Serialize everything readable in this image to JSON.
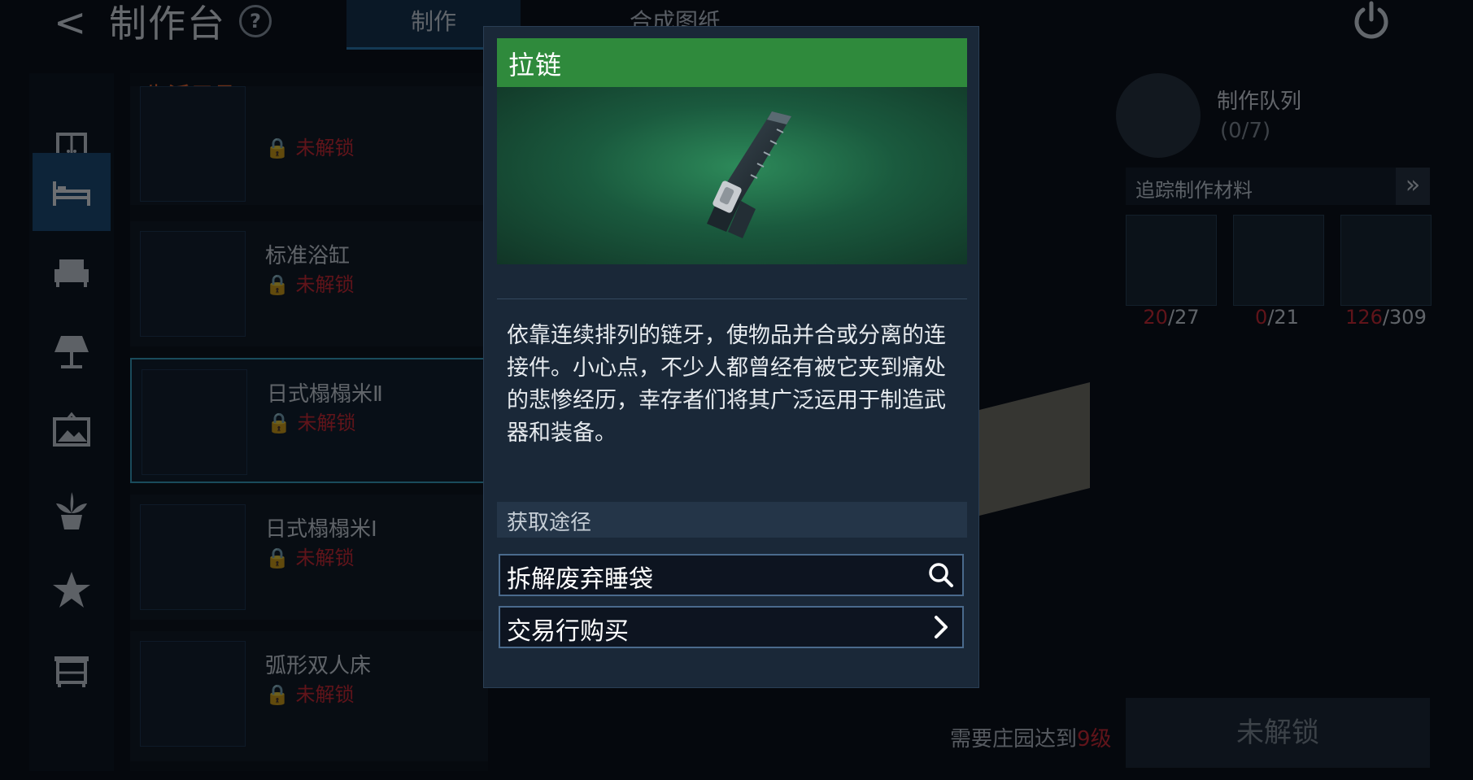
{
  "header": {
    "back_glyph": "<",
    "title": "制作台",
    "help_glyph": "?",
    "tabs": [
      {
        "label": "制作"
      },
      {
        "label": "合成图纸"
      }
    ]
  },
  "sidebar": {
    "icons": [
      "wardrobe-icon",
      "bed-icon",
      "sofa-icon",
      "lamp-icon",
      "picture-icon",
      "plant-icon",
      "star-icon",
      "cabinet-icon"
    ],
    "active_index": 1
  },
  "item_list": {
    "category": "生活用具",
    "items": [
      {
        "name": "",
        "lock": "🔒 未解锁"
      },
      {
        "name": "标准浴缸",
        "lock": "🔒 未解锁"
      },
      {
        "name": "日式榻榻米Ⅱ",
        "lock": "🔒 未解锁",
        "selected": true
      },
      {
        "name": "日式榻榻米Ⅰ",
        "lock": "🔒 未解锁"
      },
      {
        "name": "弧形双人床",
        "lock": "🔒 未解锁"
      }
    ]
  },
  "queue": {
    "label": "制作队列",
    "count": "(0/7)"
  },
  "tracking": {
    "label": "追踪制作材料",
    "expand_glyph": "»",
    "materials": [
      {
        "have": "20",
        "need": "/27"
      },
      {
        "have": "0",
        "need": "/21"
      },
      {
        "have": "126",
        "need": "/309"
      }
    ]
  },
  "requirement": {
    "prefix": "需要庄园达到",
    "level": "9级"
  },
  "unlock_button": "未解锁",
  "dialog": {
    "name": "拉链",
    "header_color": "#2f8a3c",
    "description": "依靠连续排列的链牙，使物品并合或分离的连接件。小心点，不少人都曾经有被它夹到痛处的悲惨经历，幸存者们将其广泛运用于制造武器和装备。",
    "source_label": "获取途径",
    "sources": [
      {
        "label": "拆解废弃睡袋",
        "icon": "search-icon"
      },
      {
        "label": "交易行购买",
        "icon": "chevron-right-icon"
      }
    ]
  }
}
